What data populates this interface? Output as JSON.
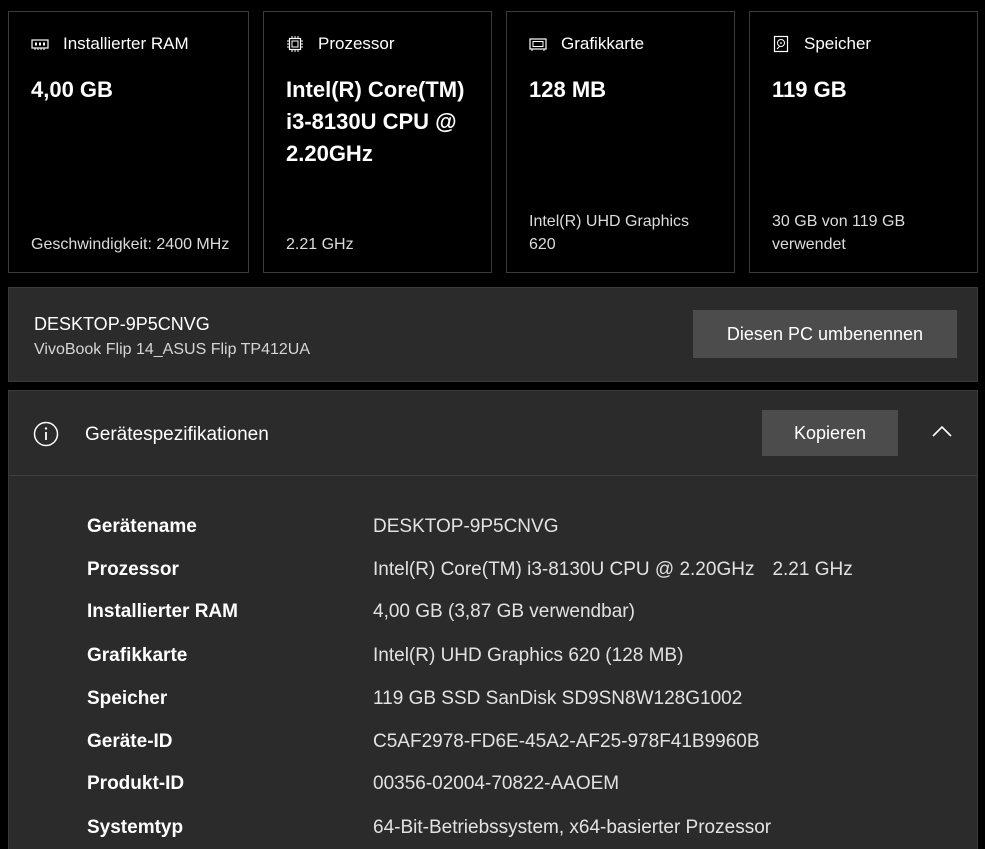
{
  "cards": [
    {
      "icon": "ram-icon",
      "label": "Installierter RAM",
      "value": "4,00 GB",
      "sub": "Geschwindigkeit: 2400 MHz"
    },
    {
      "icon": "processor-icon",
      "label": "Prozessor",
      "value": "Intel(R) Core(TM) i3-8130U CPU @ 2.20GHz",
      "sub": "2.21 GHz"
    },
    {
      "icon": "graphics-card-icon",
      "label": "Grafikkarte",
      "value": "128 MB",
      "sub": "Intel(R) UHD Graphics 620"
    },
    {
      "icon": "storage-icon",
      "label": "Speicher",
      "value": "119 GB",
      "sub": "30 GB von 119 GB verwendet"
    }
  ],
  "pc": {
    "name": "DESKTOP-9P5CNVG",
    "model": "VivoBook Flip 14_ASUS Flip TP412UA",
    "rename_label": "Diesen PC umbenennen"
  },
  "specs": {
    "title": "Gerätespezifikationen",
    "copy_label": "Kopieren",
    "rows": [
      {
        "key": "Gerätename",
        "value": "DESKTOP-9P5CNVG",
        "extra": ""
      },
      {
        "key": "Prozessor",
        "value": "Intel(R) Core(TM) i3-8130U CPU @ 2.20GHz",
        "extra": "2.21 GHz"
      },
      {
        "key": "Installierter RAM",
        "value": "4,00 GB (3,87 GB verwendbar)",
        "extra": ""
      },
      {
        "key": "Grafikkarte",
        "value": "Intel(R) UHD Graphics 620 (128 MB)",
        "extra": ""
      },
      {
        "key": "Speicher",
        "value": "119 GB SSD SanDisk SD9SN8W128G1002",
        "extra": ""
      },
      {
        "key": "Geräte-ID",
        "value": "C5AF2978-FD6E-45A2-AF25-978F41B9960B",
        "extra": ""
      },
      {
        "key": "Produkt-ID",
        "value": "00356-02004-70822-AAOEM",
        "extra": ""
      },
      {
        "key": "Systemtyp",
        "value": "64-Bit-Betriebssystem, x64-basierter Prozessor",
        "extra": ""
      }
    ]
  },
  "colors": {
    "background": "#000000",
    "panel": "#2b2b2b",
    "button": "#4c4c4c",
    "border": "#3a3a3a"
  }
}
